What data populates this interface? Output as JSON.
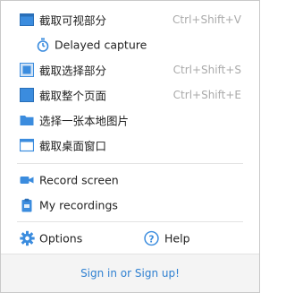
{
  "colors": {
    "accent": "#2f80d1",
    "icon_blue": "#3b8cde",
    "shortcut_gray": "#aaaaaa",
    "divider": "#e3e3e3",
    "footer_bg": "#f4f4f4"
  },
  "menu": {
    "capture_visible": {
      "label": "截取可视部分",
      "shortcut": "Ctrl+Shift+V",
      "icon": "visible-area-icon"
    },
    "delayed_capture": {
      "label": "Delayed capture",
      "icon": "timer-icon"
    },
    "capture_selection": {
      "label": "截取选择部分",
      "shortcut": "Ctrl+Shift+S",
      "icon": "selection-icon"
    },
    "capture_entire": {
      "label": "截取整个页面",
      "shortcut": "Ctrl+Shift+E",
      "icon": "full-page-icon"
    },
    "choose_local_image": {
      "label": "选择一张本地图片",
      "icon": "folder-icon"
    },
    "capture_desktop": {
      "label": "截取桌面窗口",
      "icon": "desktop-window-icon"
    },
    "record_screen": {
      "label": "Record screen",
      "icon": "video-camera-icon"
    },
    "my_recordings": {
      "label": "My recordings",
      "icon": "clipboard-icon"
    }
  },
  "bottom": {
    "options_label": "Options",
    "help_label": "Help",
    "signin_label": "Sign in or Sign up!"
  }
}
